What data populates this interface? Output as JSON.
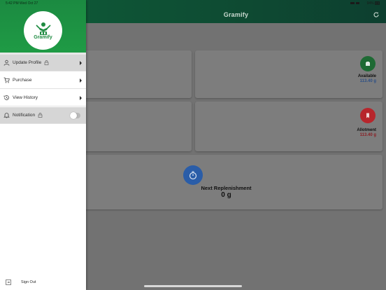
{
  "status_bar": {
    "time_date": "5:42 PM  Wed Oct 27",
    "battery": "94%"
  },
  "header": {
    "title": "Gramify",
    "refresh_icon": "refresh-icon"
  },
  "cards": {
    "available": {
      "label": "Available",
      "value": "113.40 g",
      "icon": "sugar-icon",
      "color": "#1e6a34"
    },
    "allotment": {
      "label": "Allotment",
      "value": "113.40 g",
      "icon": "bookmark-icon",
      "color": "#b7262c"
    },
    "next": {
      "label": "Next Replenishment",
      "value": "0 g",
      "icon": "timer-icon",
      "color": "#2a5da8"
    }
  },
  "drawer": {
    "logo_text": "Gramify",
    "items": [
      {
        "label": "Update Profile",
        "icon": "user-icon",
        "locked": true,
        "has_caret": true
      },
      {
        "label": "Purchase",
        "icon": "cart-icon",
        "locked": false,
        "has_caret": true
      },
      {
        "label": "View History",
        "icon": "history-icon",
        "locked": false,
        "has_caret": true
      },
      {
        "label": "Notification",
        "icon": "bell-icon",
        "locked": true,
        "toggle": false
      }
    ],
    "sign_out": "Sign Out"
  },
  "colors": {
    "brand_green": "#1f9b45",
    "header_dark": "#0f5d38"
  }
}
